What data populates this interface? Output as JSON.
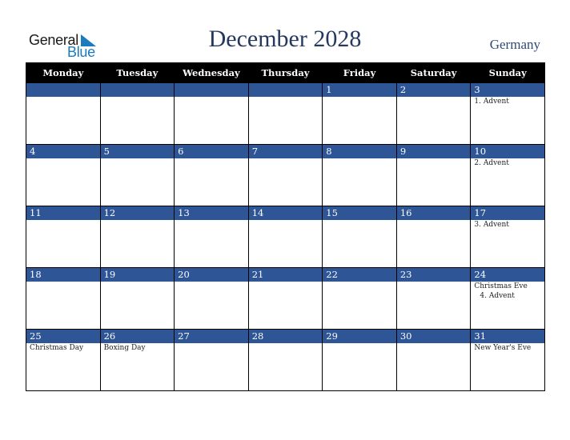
{
  "logo": {
    "line1": "General",
    "line2": "Blue"
  },
  "header": {
    "title": "December 2028",
    "country": "Germany"
  },
  "weekdays": [
    "Monday",
    "Tuesday",
    "Wednesday",
    "Thursday",
    "Friday",
    "Saturday",
    "Sunday"
  ],
  "weeks": [
    [
      {
        "day": "",
        "events": []
      },
      {
        "day": "",
        "events": []
      },
      {
        "day": "",
        "events": []
      },
      {
        "day": "",
        "events": []
      },
      {
        "day": "1",
        "events": []
      },
      {
        "day": "2",
        "events": []
      },
      {
        "day": "3",
        "events": [
          "1. Advent"
        ]
      }
    ],
    [
      {
        "day": "4",
        "events": []
      },
      {
        "day": "5",
        "events": []
      },
      {
        "day": "6",
        "events": []
      },
      {
        "day": "7",
        "events": []
      },
      {
        "day": "8",
        "events": []
      },
      {
        "day": "9",
        "events": []
      },
      {
        "day": "10",
        "events": [
          "2. Advent"
        ]
      }
    ],
    [
      {
        "day": "11",
        "events": []
      },
      {
        "day": "12",
        "events": []
      },
      {
        "day": "13",
        "events": []
      },
      {
        "day": "14",
        "events": []
      },
      {
        "day": "15",
        "events": []
      },
      {
        "day": "16",
        "events": []
      },
      {
        "day": "17",
        "events": [
          "3. Advent"
        ]
      }
    ],
    [
      {
        "day": "18",
        "events": []
      },
      {
        "day": "19",
        "events": []
      },
      {
        "day": "20",
        "events": []
      },
      {
        "day": "21",
        "events": []
      },
      {
        "day": "22",
        "events": []
      },
      {
        "day": "23",
        "events": []
      },
      {
        "day": "24",
        "events": [
          "Christmas Eve",
          "4. Advent"
        ]
      }
    ],
    [
      {
        "day": "25",
        "events": [
          "Christmas Day"
        ]
      },
      {
        "day": "26",
        "events": [
          "Boxing Day"
        ]
      },
      {
        "day": "27",
        "events": []
      },
      {
        "day": "28",
        "events": []
      },
      {
        "day": "29",
        "events": []
      },
      {
        "day": "30",
        "events": []
      },
      {
        "day": "31",
        "events": [
          "New Year's Eve"
        ]
      }
    ]
  ],
  "colors": {
    "day_band": "#2e5596",
    "header_bg": "#000000",
    "title": "#25395f",
    "logo_blue": "#1a7bbf"
  }
}
